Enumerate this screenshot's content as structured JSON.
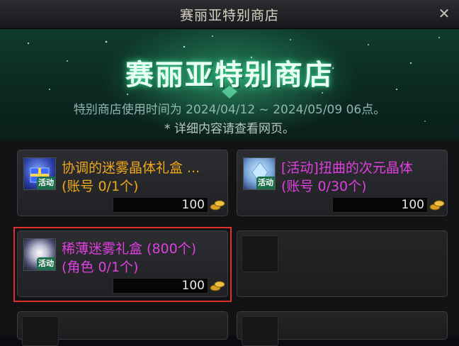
{
  "window": {
    "title": "赛丽亚特别商店",
    "close_label": "✕"
  },
  "banner": {
    "title": "赛丽亚特别商店",
    "period": "特别商店使用时间为 2024/04/12 ~ 2024/05/09 06点。",
    "note": "* 详细内容请查看网页。"
  },
  "items": [
    {
      "name": "协调的迷雾晶体礼盒 ...",
      "limit": "(账号 0/1个)",
      "price": "100",
      "badge": "活动",
      "color": "#f0a818"
    },
    {
      "name": "[活动]扭曲的次元晶体",
      "limit": "(账号 0/30个)",
      "price": "100",
      "badge": "活动",
      "color": "#e040e0"
    },
    {
      "name": "稀薄迷雾礼盒 (800个)",
      "limit": "(角色 0/1个)",
      "price": "100",
      "badge": "活动",
      "color": "#e040e0"
    }
  ],
  "colors": {
    "highlight": "#e0302e",
    "gold": "#f0a818",
    "pink": "#e040e0"
  },
  "icons": {
    "close": "close-icon",
    "currency": "gold-coin-icon"
  }
}
